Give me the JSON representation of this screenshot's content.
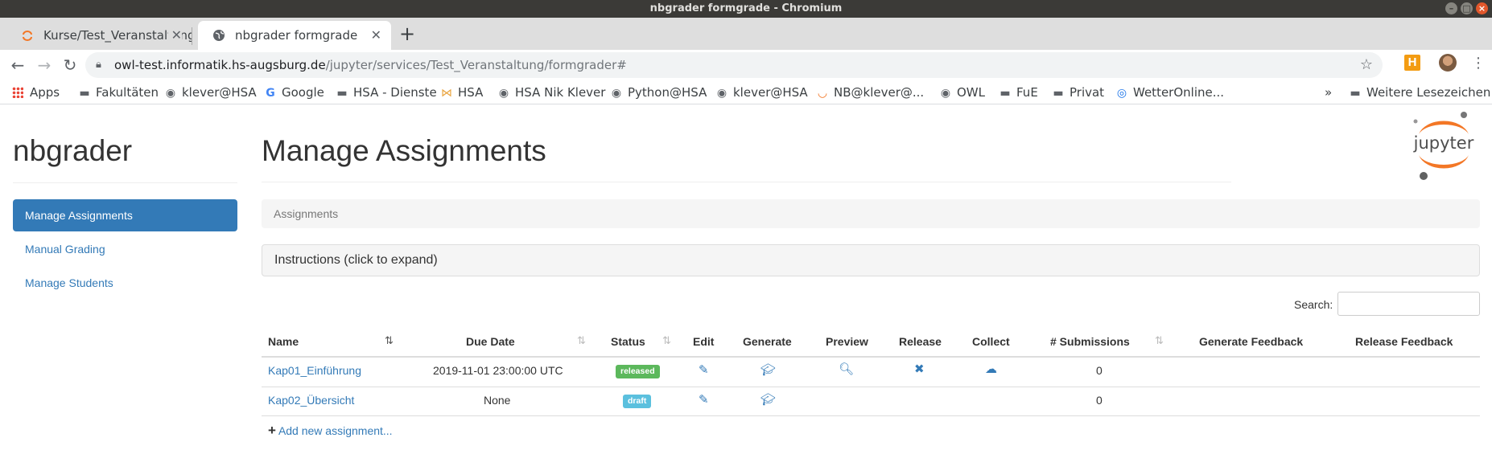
{
  "window": {
    "title": "nbgrader formgrade - Chromium"
  },
  "tabs": [
    {
      "label": "Kurse/Test_Veranstaltung",
      "active": false
    },
    {
      "label": "nbgrader formgrade",
      "active": true
    }
  ],
  "address": {
    "host": "owl-test.informatik.hs-augsburg.de",
    "path": "/jupyter/services/Test_Veranstaltung/formgrader#"
  },
  "bookmarks": {
    "items": [
      "Apps",
      "Fakultäten",
      "klever@HSA",
      "Google",
      "HSA - Dienste",
      "HSA",
      "HSA Nik Klever",
      "Python@HSA",
      "klever@HSA",
      "NB@klever@...",
      "OWL",
      "FuE",
      "Privat",
      "WetterOnline..."
    ],
    "overflow": "»",
    "other": "Weitere Lesezeichen"
  },
  "app": {
    "brand": "nbgrader"
  },
  "sidebar": {
    "items": [
      {
        "label": "Manage Assignments",
        "active": true
      },
      {
        "label": "Manual Grading",
        "active": false
      },
      {
        "label": "Manage Students",
        "active": false
      }
    ]
  },
  "main": {
    "title": "Manage Assignments",
    "breadcrumb": "Assignments",
    "instructions": "Instructions (click to expand)",
    "search_label": "Search:",
    "search_value": "",
    "add_label": "Add new assignment...",
    "logo_text": "jupyter"
  },
  "table": {
    "headers": [
      "Name",
      "Due Date",
      "Status",
      "Edit",
      "Generate",
      "Preview",
      "Release",
      "Collect",
      "# Submissions",
      "Generate Feedback",
      "Release Feedback"
    ],
    "rows": [
      {
        "name": "Kap01_Einführung",
        "due": "2019-11-01 23:00:00 UTC",
        "status": "released",
        "submissions": "0"
      },
      {
        "name": "Kap02_Übersicht",
        "due": "None",
        "status": "draft",
        "submissions": "0"
      }
    ]
  },
  "colors": {
    "primary": "#337ab7",
    "released": "#5cb85c",
    "draft": "#5bc0de"
  }
}
